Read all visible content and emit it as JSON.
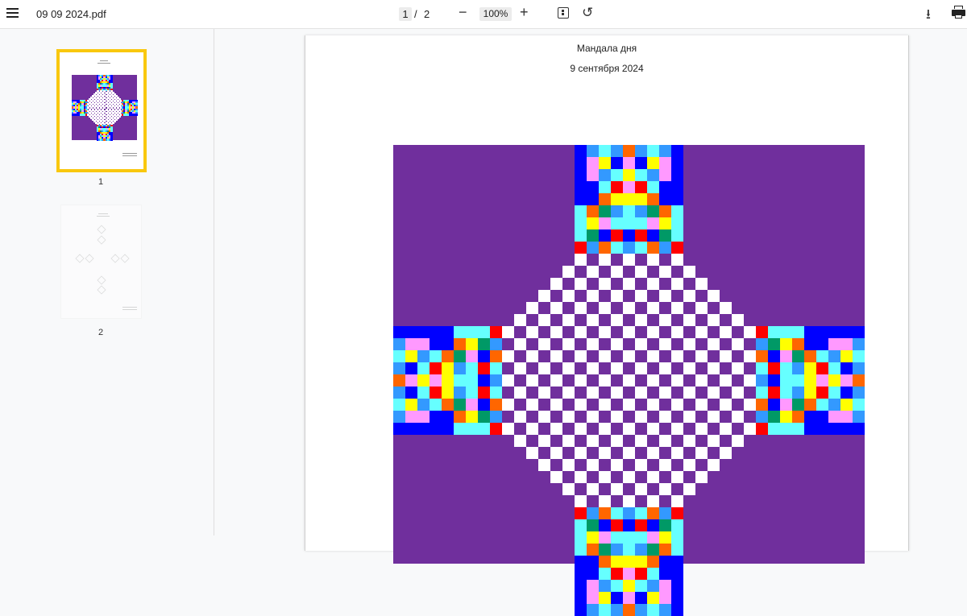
{
  "toolbar": {
    "title": "09 09 2024.pdf",
    "current_page": "1",
    "separator": "/",
    "total_pages": "2",
    "zoom": "100%",
    "zoom_out": "−",
    "zoom_in": "+",
    "rotate": "↺",
    "download": "⭳"
  },
  "thumbnails": [
    {
      "label": "1",
      "selected": true
    },
    {
      "label": "2",
      "selected": false
    }
  ],
  "page": {
    "heading": "Мандала дня",
    "date": "9 сентября 2024"
  },
  "colors": {
    "background": "#702f9d",
    "selection_border": "#f9c80e",
    "palette": [
      "#ffffff",
      "#ff99ff",
      "#0000ff",
      "#3399ff",
      "#66ffff",
      "#ffff00",
      "#ff0000",
      "#ff6600",
      "#009966"
    ]
  },
  "icons": [
    "menu-icon",
    "zoom-out-icon",
    "zoom-in-icon",
    "fit-page-icon",
    "rotate-icon",
    "download-icon",
    "print-icon"
  ]
}
